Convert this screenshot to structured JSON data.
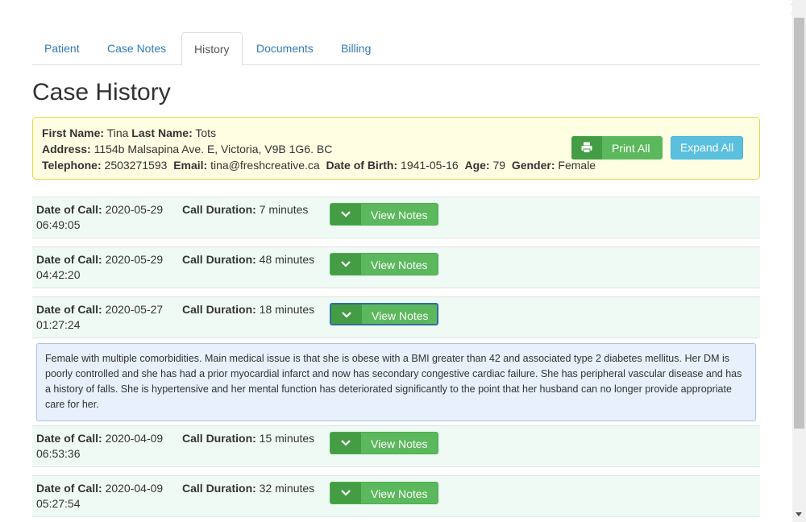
{
  "tabs": [
    {
      "label": "Patient",
      "active": false
    },
    {
      "label": "Case Notes",
      "active": false
    },
    {
      "label": "History",
      "active": true
    },
    {
      "label": "Documents",
      "active": false
    },
    {
      "label": "Billing",
      "active": false
    }
  ],
  "page_title": "Case History",
  "patient": {
    "first_name_label": "First Name:",
    "first_name": "Tina",
    "last_name_label": "Last Name:",
    "last_name": "Tots",
    "address_label": "Address:",
    "address": "1154b Malsapina Ave. E, Victoria, V9B 1G6. BC",
    "telephone_label": "Telephone:",
    "telephone": "2503271593",
    "email_label": "Email:",
    "email": "tina@freshcreative.ca",
    "dob_label": "Date of Birth:",
    "dob": "1941-05-16",
    "age_label": "Age:",
    "age": "79",
    "gender_label": "Gender:",
    "gender": "Female"
  },
  "buttons": {
    "print_all": "Print All",
    "expand_all": "Expand All",
    "view_notes": "View Notes"
  },
  "labels": {
    "date_of_call": "Date of Call:",
    "call_duration": "Call Duration:"
  },
  "calls": [
    {
      "date": "2020-05-29",
      "time": "06:49:05",
      "duration": "7 minutes"
    },
    {
      "date": "2020-05-29",
      "time": "04:42:20",
      "duration": "48 minutes"
    },
    {
      "date": "2020-05-27",
      "time": "01:27:24",
      "duration": "18 minutes"
    },
    {
      "date": "2020-04-09",
      "time": "06:53:36",
      "duration": "15 minutes"
    },
    {
      "date": "2020-04-09",
      "time": "05:27:54",
      "duration": "32 minutes"
    }
  ],
  "expanded_note": "Female with multiple comorbidities. Main medical issue is that she is obese with a BMI greater than 42 and associated type 2 diabetes mellitus. Her DM is poorly controlled and she has had a prior myocardial infarct and now has secondary congestive cardiac failure. She has peripheral vascular disease and has a history of falls. She is hypertensive and her mental function has deteriorated significantly to the point that her husband can no longer provide appropriate care for her.",
  "colors": {
    "primary_link": "#337ab7",
    "success": "#5cb85c",
    "success_dark": "#449d44",
    "info": "#5bc0de",
    "patient_bg": "#fefee3",
    "row_bg": "#f0faf5",
    "note_bg": "#e7f0fb"
  }
}
